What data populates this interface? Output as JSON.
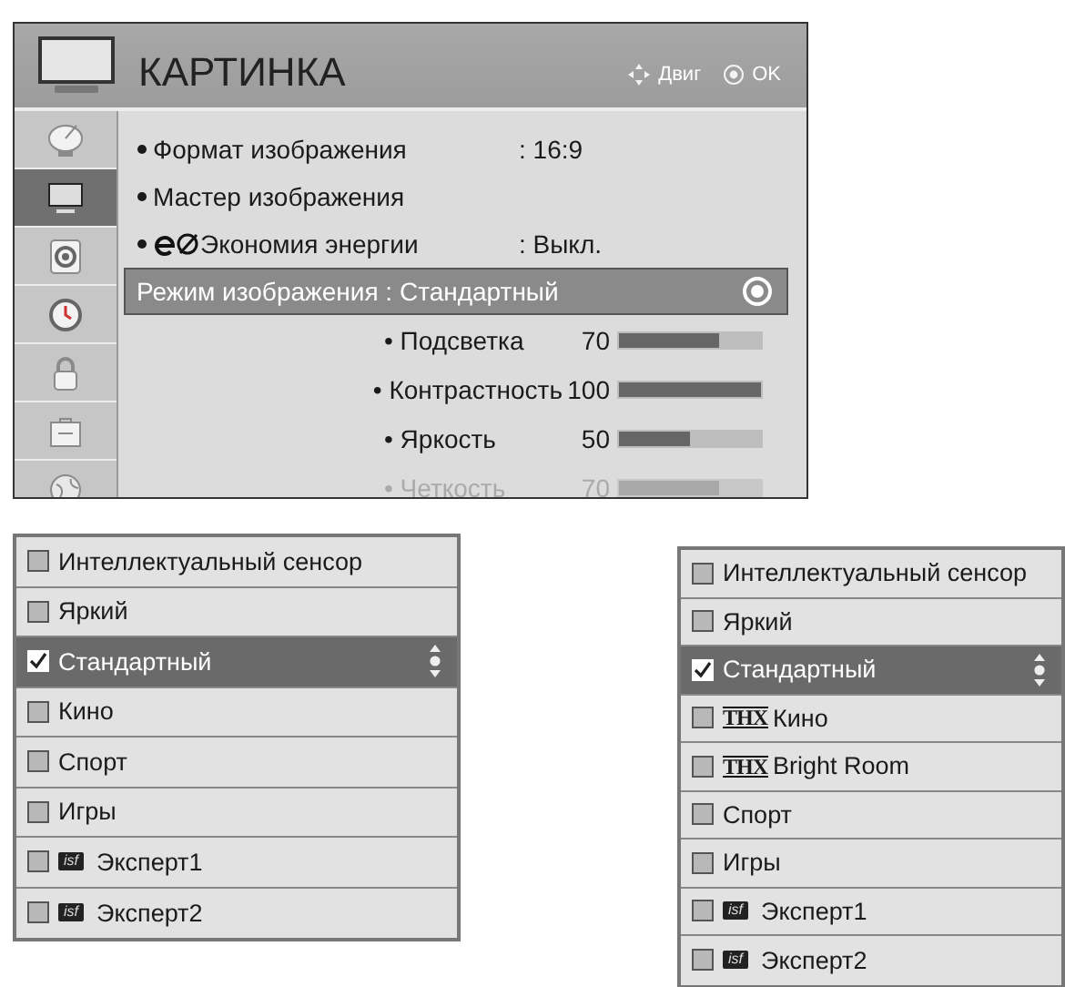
{
  "menu": {
    "title": "КАРТИНКА",
    "hints": [
      {
        "kind": "move",
        "label": "Двиг"
      },
      {
        "kind": "ok",
        "label": "OK"
      }
    ],
    "sidebar": [
      {
        "selected": false
      },
      {
        "selected": true
      },
      {
        "selected": false
      },
      {
        "selected": false
      },
      {
        "selected": false
      },
      {
        "selected": false
      },
      {
        "selected": false
      }
    ],
    "rows": [
      {
        "kind": "setting",
        "label": "Формат изображения",
        "value": ": 16:9",
        "selected": false
      },
      {
        "kind": "setting",
        "label": "Мастер изображения",
        "selected": false
      },
      {
        "kind": "setting",
        "eco": true,
        "label": "Экономия энергии",
        "value": ": Выкл.",
        "selected": false
      },
      {
        "kind": "setting",
        "label": "Режим изображения : Стандартный",
        "selected": true
      },
      {
        "kind": "slider",
        "label": "• Подсветка",
        "value": "70",
        "level": 0.7,
        "disabled": false
      },
      {
        "kind": "slider",
        "label": "• Контрастность",
        "value": "100",
        "level": 1,
        "disabled": false
      },
      {
        "kind": "slider",
        "label": "• Яркость",
        "value": "50",
        "level": 0.5,
        "disabled": false
      },
      {
        "kind": "slider",
        "label": "• Четкость",
        "value": "70",
        "level": 0.7,
        "disabled": true
      }
    ]
  },
  "lists": [
    {
      "items": [
        {
          "label": "Интеллектуальный сенсор",
          "checked": false,
          "selected": false
        },
        {
          "label": "Яркий",
          "checked": false,
          "selected": false
        },
        {
          "label": "Стандартный",
          "checked": true,
          "selected": true
        },
        {
          "label": "Кино",
          "checked": false,
          "selected": false
        },
        {
          "label": "Спорт",
          "checked": false,
          "selected": false
        },
        {
          "label": "Игры",
          "checked": false,
          "selected": false
        },
        {
          "label": "Эксперт1",
          "badge": "isf",
          "checked": false,
          "selected": false
        },
        {
          "label": "Эксперт2",
          "badge": "isf",
          "checked": false,
          "selected": false
        }
      ]
    },
    {
      "items": [
        {
          "label": "Интеллектуальный сенсор",
          "checked": false,
          "selected": false
        },
        {
          "label": "Яркий",
          "checked": false,
          "selected": false
        },
        {
          "label": "Стандартный",
          "checked": true,
          "selected": true
        },
        {
          "label": "Кино",
          "badge": "THX",
          "checked": false,
          "selected": false
        },
        {
          "label": "Bright Room",
          "badge": "THX",
          "checked": false,
          "selected": false
        },
        {
          "label": "Спорт",
          "checked": false,
          "selected": false
        },
        {
          "label": "Игры",
          "checked": false,
          "selected": false
        },
        {
          "label": "Эксперт1",
          "badge": "isf",
          "checked": false,
          "selected": false
        },
        {
          "label": "Эксперт2",
          "badge": "isf",
          "checked": false,
          "selected": false
        }
      ]
    }
  ]
}
